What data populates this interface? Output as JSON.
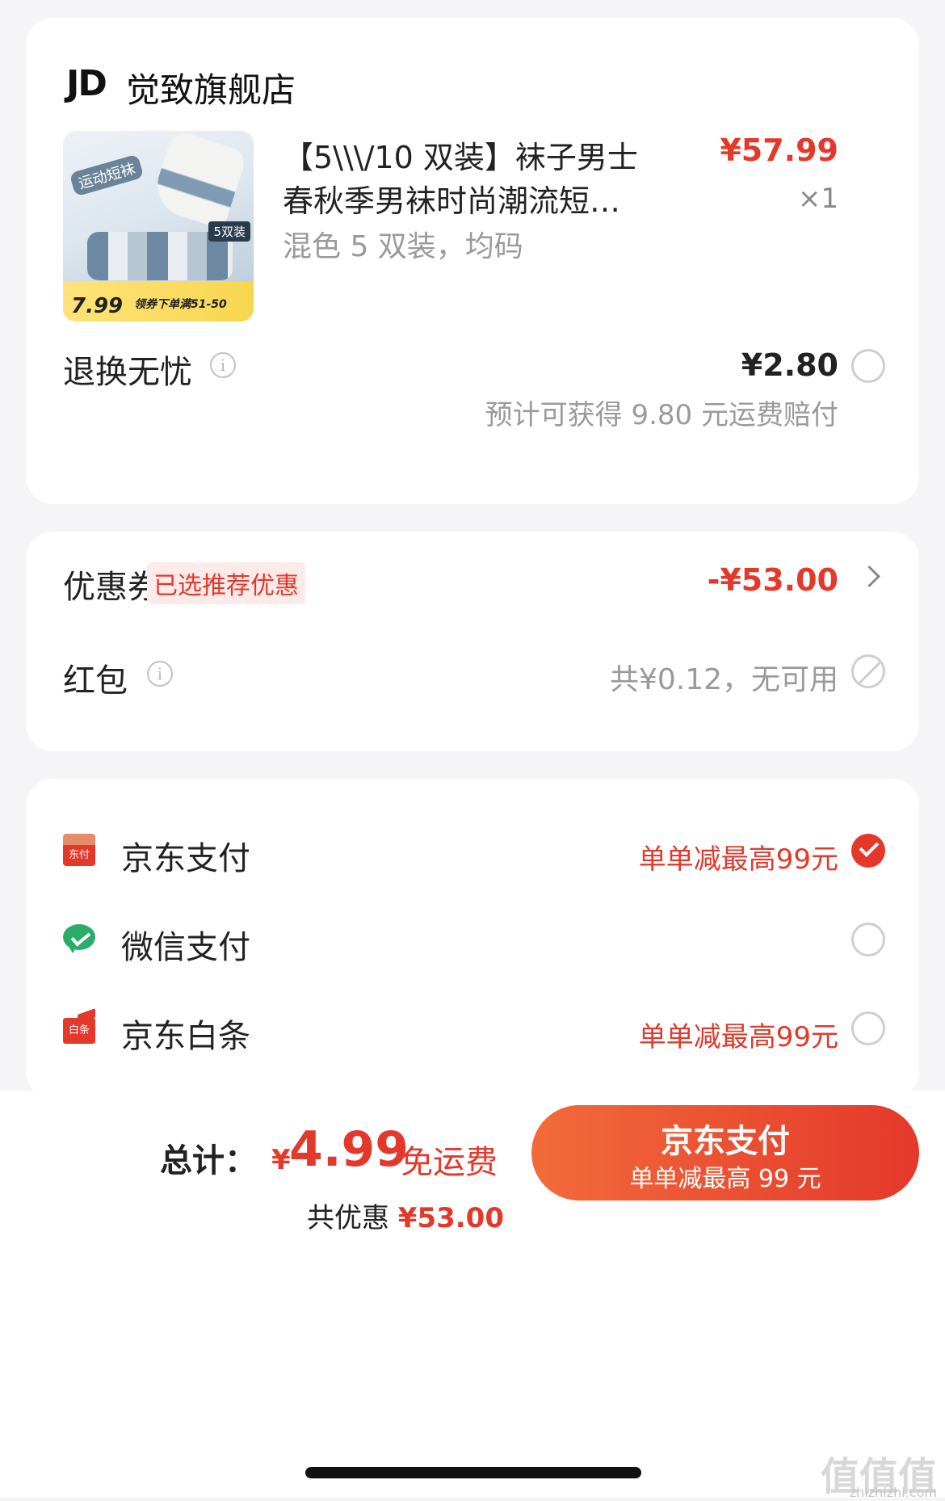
{
  "store": {
    "logo": "JD",
    "name": "觉致旗舰店"
  },
  "product": {
    "title_line1": "【5\\\\\\/10 双装】袜子男士",
    "title_line2": "春秋季男袜时尚潮流短…",
    "spec": "混色 5 双装，均码",
    "price": "¥57.99",
    "qty": "×1",
    "thumb": {
      "tag": "运动短袜",
      "count_tag": "5双装",
      "band_price": "7.99",
      "band_text": "领券下单满51-50"
    }
  },
  "return_service": {
    "label": "退换无忧",
    "info_icon": "i",
    "price": "¥2.80",
    "note": "预计可获得 9.80 元运费赔付"
  },
  "coupon": {
    "label": "优惠券",
    "badge": "已选推荐优惠",
    "value": "-¥53.00"
  },
  "redpack": {
    "label": "红包",
    "info_icon": "i",
    "value": "共¥0.12，无可用"
  },
  "payment": {
    "jdpay": {
      "label": "京东支付",
      "promo": "单单减最高99元",
      "icon_text": "东付",
      "selected": true
    },
    "wechat": {
      "label": "微信支付",
      "selected": false
    },
    "baitiao": {
      "label": "京东白条",
      "promo": "单单减最高99元",
      "icon_text": "白条",
      "selected": false
    }
  },
  "summary": {
    "total_label": "总计：",
    "currency": "¥",
    "total": "4.99",
    "shipping": "免运费",
    "saved_label": "共优惠 ",
    "saved_value": "¥53.00"
  },
  "pay_button": {
    "label": "京东支付",
    "sub": "单单减最高 99 元"
  },
  "watermark": {
    "logo": "值值值",
    "url": "zhizhizhi.com"
  },
  "colors": {
    "accent": "#e4382b",
    "background": "#f5f5f7",
    "wechat_green": "#2aae67"
  }
}
